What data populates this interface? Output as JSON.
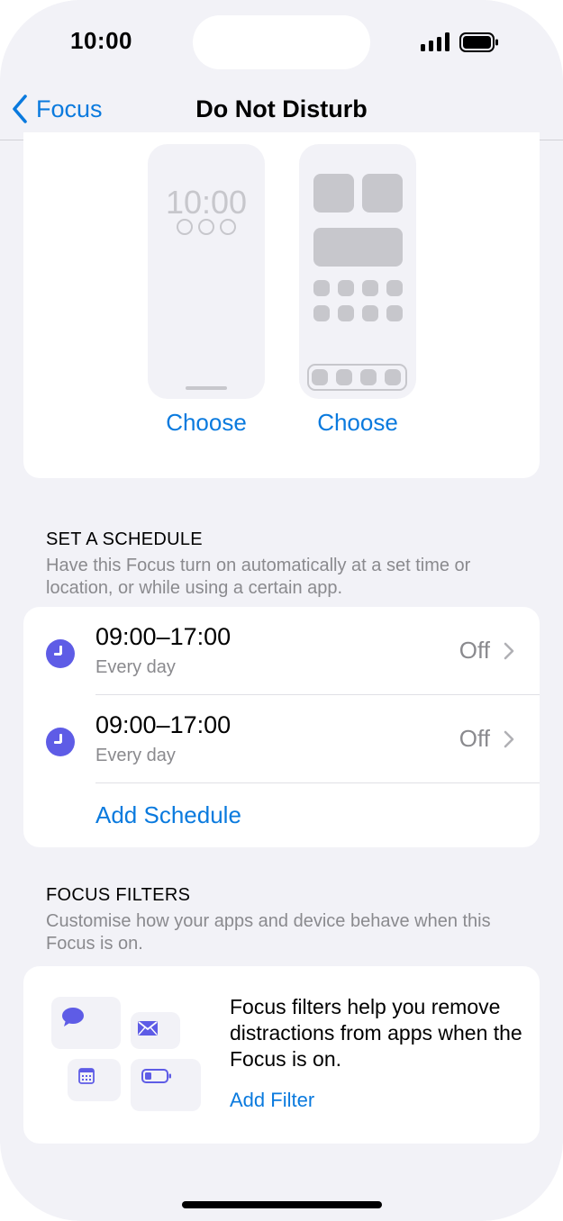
{
  "status_bar": {
    "time": "10:00"
  },
  "nav": {
    "back_label": "Focus",
    "title": "Do Not Disturb"
  },
  "customize": {
    "lock_screen_time": "10:00",
    "lock_choose_label": "Choose",
    "home_choose_label": "Choose"
  },
  "schedule": {
    "header": "SET A SCHEDULE",
    "description": "Have this Focus turn on automatically at a set time or location, or while using a certain app.",
    "items": [
      {
        "time": "09:00–17:00",
        "days": "Every day",
        "status": "Off"
      },
      {
        "time": "09:00–17:00",
        "days": "Every day",
        "status": "Off"
      }
    ],
    "add_label": "Add Schedule"
  },
  "filters": {
    "header": "FOCUS FILTERS",
    "description": "Customise how your apps and device behave when this Focus is on.",
    "body": "Focus filters help you remove distractions from apps when the Focus is on.",
    "add_label": "Add Filter",
    "icons": [
      "chat-bubble-icon",
      "mail-icon",
      "calendar-icon",
      "battery-icon"
    ]
  },
  "colors": {
    "accent": "#0a7ade",
    "schedule_icon": "#5e5ce6",
    "background": "#f2f2f7"
  }
}
